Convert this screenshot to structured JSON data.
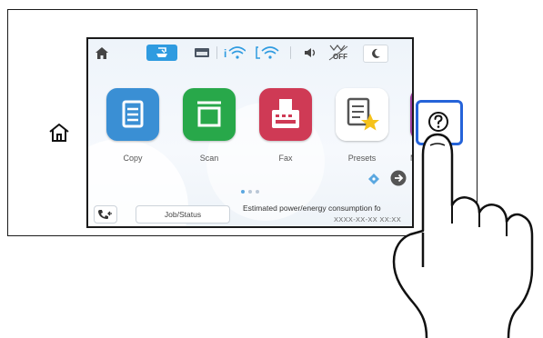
{
  "panel": {
    "tiles": [
      {
        "label": "Copy",
        "color": "#3a8fd4",
        "icon": "copy-document-icon"
      },
      {
        "label": "Scan",
        "color": "#28a84a",
        "icon": "scan-tray-icon"
      },
      {
        "label": "Fax",
        "color": "#cf3a55",
        "icon": "fax-machine-icon"
      },
      {
        "label": "Presets",
        "color": "#ffffff",
        "icon": "presets-star-icon"
      },
      {
        "label": "M",
        "color": "#9a3c9c",
        "icon": "more-app-icon"
      }
    ],
    "job_status_label": "Job/Status",
    "estimated_text": "Estimated power/energy consumption fo",
    "date_text": "XXXX-XX-XX XX:XX",
    "page_indicator": {
      "pages": 3,
      "current": 1
    },
    "accent_blue": "#2563d9"
  }
}
